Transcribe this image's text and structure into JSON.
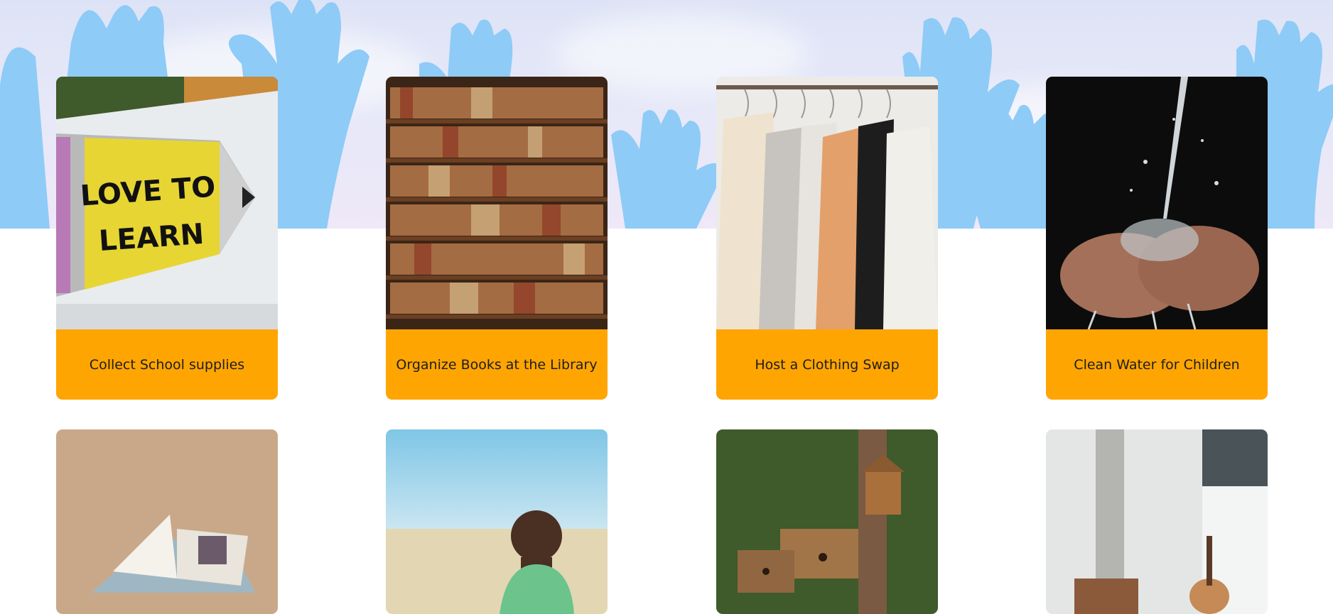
{
  "hero": {
    "description_icon": "raised-hands-illustration",
    "colors": {
      "hands": "#8ECBF7",
      "sky": "#E3E6F7"
    }
  },
  "activities": [
    {
      "title": "Collect School supplies",
      "image": "love-to-learn-pencil-sign-icon"
    },
    {
      "title": "Organize Books at the Library",
      "image": "library-bookshelf-icon"
    },
    {
      "title": "Host a Clothing Swap",
      "image": "clothing-rack-icon"
    },
    {
      "title": "Clean Water for Children",
      "image": "hands-water-icon"
    }
  ],
  "more_activities": [
    {
      "image": "open-book-icon"
    },
    {
      "image": "child-portrait-icon"
    },
    {
      "image": "birdhouses-icon"
    },
    {
      "image": "music-room-icon"
    }
  ],
  "sign_text": {
    "line1": "LOVE TO",
    "line2": "LEARN"
  },
  "colors": {
    "caption_bg": "#FFA502",
    "caption_text": "#1D1D1D"
  }
}
